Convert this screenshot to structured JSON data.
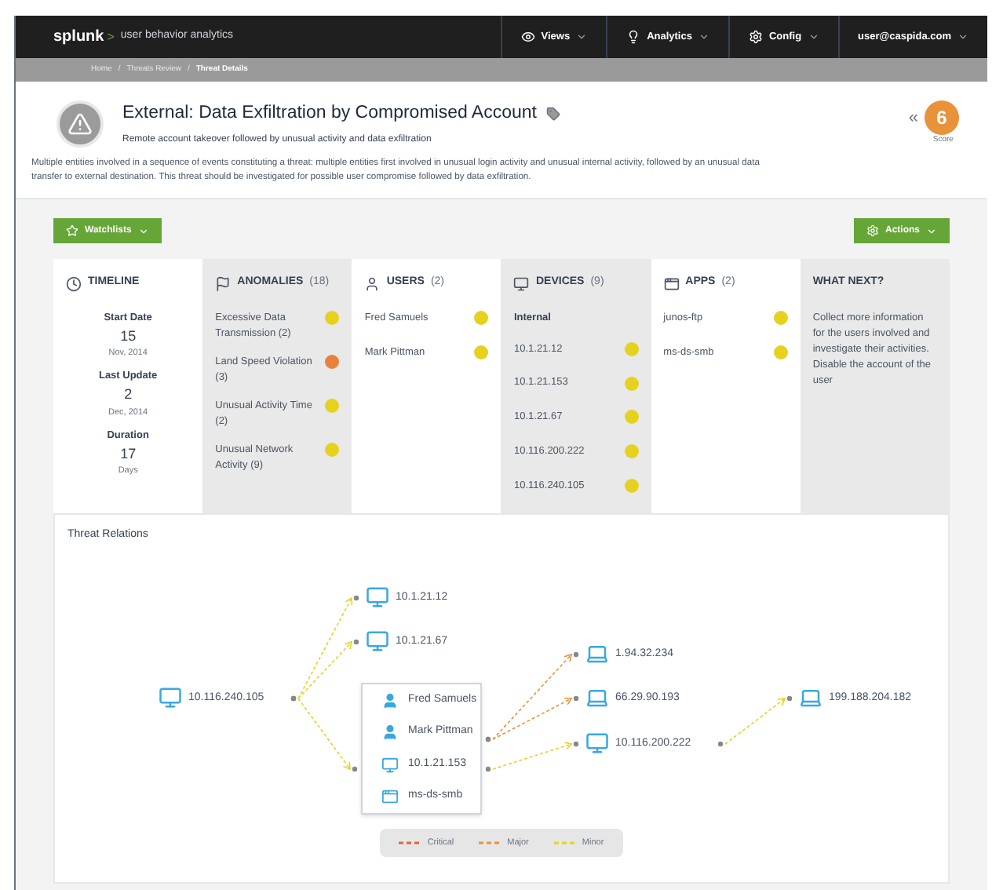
{
  "navbar": {
    "logo": "splunk",
    "logo_arrow": ">",
    "product": "user behavior analytics",
    "menus": [
      {
        "label": "Views"
      },
      {
        "label": "Analytics"
      },
      {
        "label": "Config"
      },
      {
        "label": "user@caspida.com"
      }
    ]
  },
  "breadcrumb": [
    {
      "label": "Home",
      "current": false,
      "separator": "/"
    },
    {
      "label": "Threats Review",
      "current": false,
      "separator": "/"
    },
    {
      "label": "Threat Details",
      "current": true
    }
  ],
  "threat": {
    "title": "External: Data Exfiltration by Compromised Account",
    "subtitle": "Remote account takeover followed by unusual activity and data exfiltration",
    "description": "Multiple entities involved in a sequence of events constituting a threat: multiple entities first involved in unusual login activity and unusual internal activity, followed by an unusual data transfer to external destination. This threat should be investigated for possible user compromise followed by data exfiltration.",
    "collapse": "«",
    "score": "6",
    "score_label": "Score"
  },
  "buttons": {
    "watchlists": "Watchlists",
    "actions": "Actions"
  },
  "timeline": {
    "title": "TIMELINE",
    "items": [
      {
        "label": "Start Date",
        "value": "15",
        "unit": "Nov, 2014"
      },
      {
        "label": "Last Update",
        "value": "2",
        "unit": "Dec, 2014"
      },
      {
        "label": "Duration",
        "value": "17",
        "unit": "Days"
      }
    ]
  },
  "anomalies": {
    "title": "ANOMALIES",
    "count": "(18)",
    "items": [
      {
        "name": "Excessive Data Transmission",
        "count": "(2)",
        "color": "#e6d21e"
      },
      {
        "name": "Land Speed Violation",
        "count": "(3)",
        "color": "#e8823a"
      },
      {
        "name": "Unusual Activity Time",
        "count": "(2)",
        "color": "#e6d21e"
      },
      {
        "name": "Unusual Network Activity",
        "count": "(9)",
        "color": "#e6d21e"
      }
    ]
  },
  "users": {
    "title": "USERS",
    "count": "(2)",
    "items": [
      {
        "name": "Fred Samuels",
        "color": "#e6d21e"
      },
      {
        "name": "Mark Pittman",
        "color": "#e6d21e"
      }
    ]
  },
  "devices": {
    "title": "DEVICES",
    "count": "(9)",
    "group": "Internal",
    "items": [
      {
        "name": "10.1.21.12",
        "color": "#e6d21e"
      },
      {
        "name": "10.1.21.153",
        "color": "#e6d21e"
      },
      {
        "name": "10.1.21.67",
        "color": "#e6d21e"
      },
      {
        "name": "10.116.200.222",
        "color": "#e6d21e"
      },
      {
        "name": "10.116.240.105",
        "color": "#e6d21e"
      }
    ]
  },
  "apps": {
    "title": "APPS",
    "count": "(2)",
    "items": [
      {
        "name": "junos-ftp",
        "color": "#e6d21e"
      },
      {
        "name": "ms-ds-smb",
        "color": "#e6d21e"
      }
    ]
  },
  "what_next": {
    "title": "WHAT NEXT?",
    "text": "Collect more information for the users involved and investigate their activities. Disable the account of the user"
  },
  "relations": {
    "title": "Threat Relations",
    "nodes": [
      {
        "label": "10.116.240.105",
        "kind": "device"
      },
      {
        "label": "10.1.21.12",
        "kind": "device"
      },
      {
        "label": "10.1.21.67",
        "kind": "device"
      },
      {
        "label": "1.94.32.234",
        "kind": "external"
      },
      {
        "label": "66.29.90.193",
        "kind": "external"
      },
      {
        "label": "10.116.200.222",
        "kind": "device"
      },
      {
        "label": "199.188.204.182",
        "kind": "external"
      }
    ],
    "group": [
      {
        "label": "Fred Samuels",
        "kind": "user"
      },
      {
        "label": "Mark Pittman",
        "kind": "user"
      },
      {
        "label": "10.1.21.153",
        "kind": "device"
      },
      {
        "label": "ms-ds-smb",
        "kind": "app"
      }
    ],
    "edges": [
      {
        "kind": "minor"
      },
      {
        "kind": "minor"
      },
      {
        "kind": "minor"
      },
      {
        "kind": "major"
      },
      {
        "kind": "major"
      },
      {
        "kind": "minor"
      },
      {
        "kind": "minor"
      }
    ],
    "legend": [
      {
        "label": "Critical",
        "kind": "critical"
      },
      {
        "label": "Major",
        "kind": "major"
      },
      {
        "label": "Minor",
        "kind": "minor"
      }
    ]
  }
}
